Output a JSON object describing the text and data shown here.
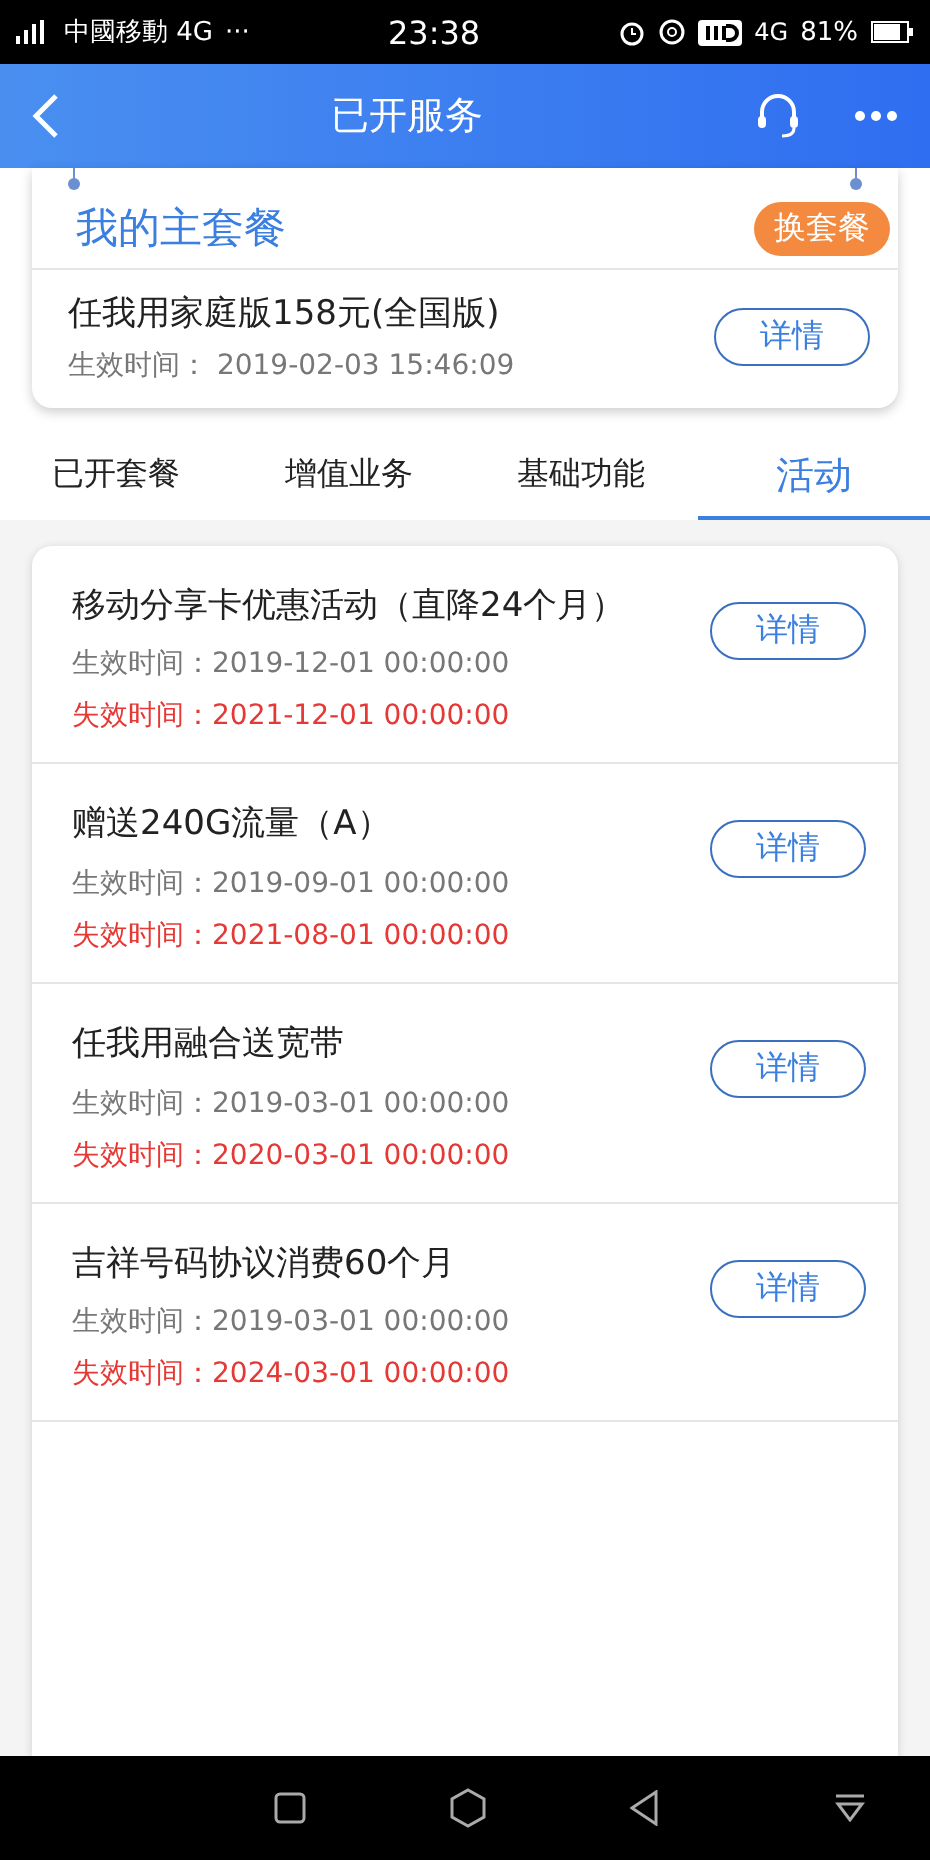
{
  "status_bar": {
    "carrier": "中國移動 4G",
    "more": "···",
    "time": "23:38",
    "network": "4G",
    "battery": "81%"
  },
  "header": {
    "title": "已开服务"
  },
  "main_plan": {
    "title": "我的主套餐",
    "change_button": "换套餐",
    "plan_name": "任我用家庭版158元(全国版)",
    "effective_label": "生效时间：",
    "effective_time": "2019-02-03  15:46:09",
    "detail_button": "详情"
  },
  "tabs": [
    {
      "label": "已开套餐",
      "selected": false
    },
    {
      "label": "增值业务",
      "selected": false
    },
    {
      "label": "基础功能",
      "selected": false
    },
    {
      "label": "活动",
      "selected": true
    }
  ],
  "activities": [
    {
      "name": "移动分享卡优惠活动（直降24个月）",
      "effective": "生效时间：2019-12-01 00:00:00",
      "expiry": "失效时间：2021-12-01 00:00:00",
      "button": "详情"
    },
    {
      "name": "赠送240G流量（A）",
      "effective": "生效时间：2019-09-01 00:00:00",
      "expiry": "失效时间：2021-08-01 00:00:00",
      "button": "详情"
    },
    {
      "name": "任我用融合送宽带",
      "effective": "生效时间：2019-03-01 00:00:00",
      "expiry": "失效时间：2020-03-01 00:00:00",
      "button": "详情"
    },
    {
      "name": "吉祥号码协议消费60个月",
      "effective": "生效时间：2019-03-01 00:00:00",
      "expiry": "失效时间：2024-03-01 00:00:00",
      "button": "详情"
    }
  ]
}
